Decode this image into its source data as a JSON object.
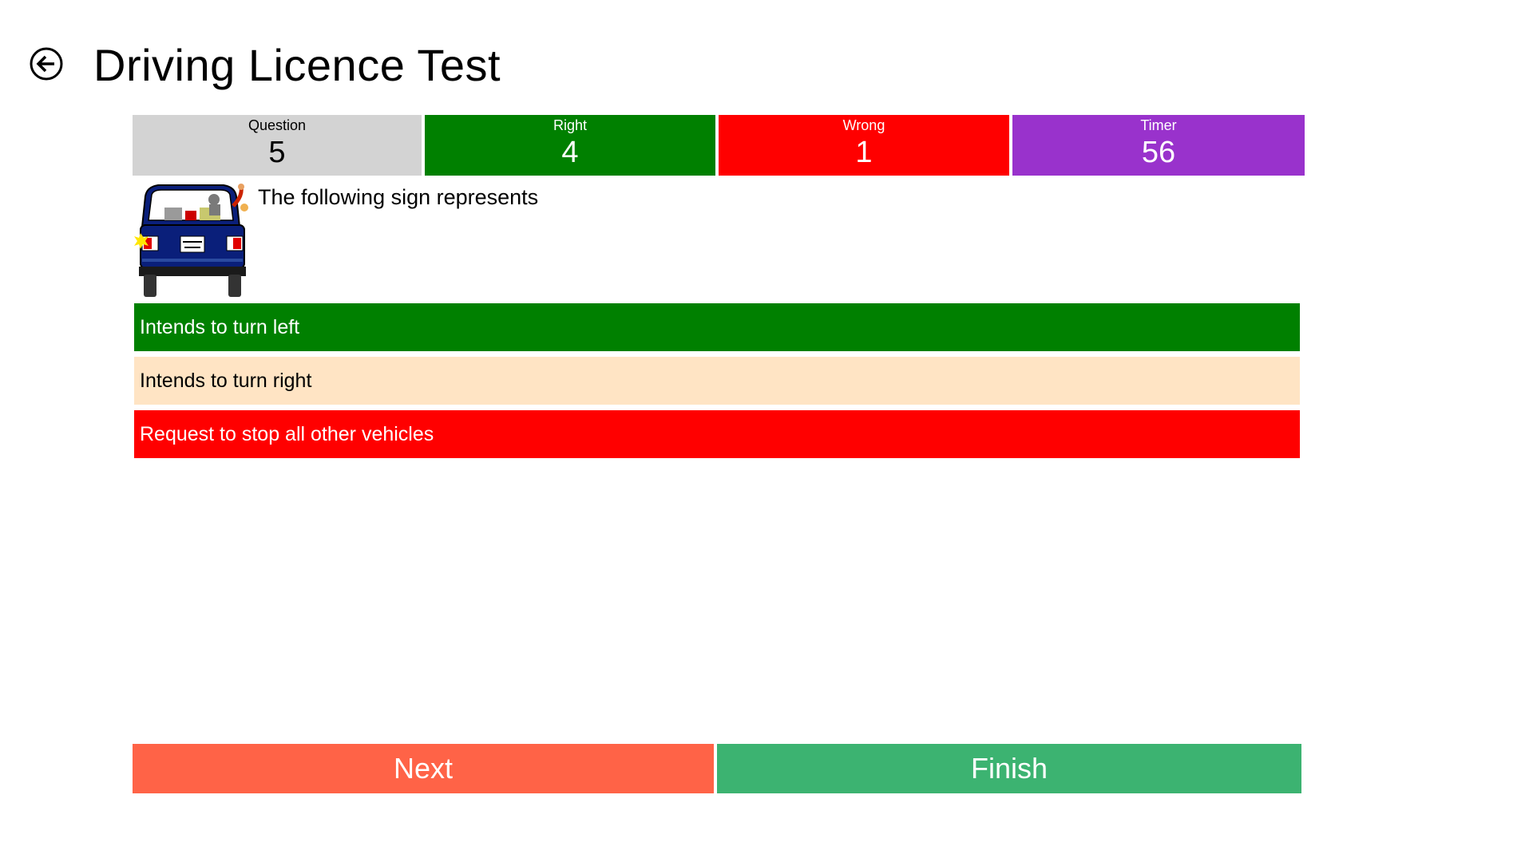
{
  "header": {
    "title": "Driving Licence Test",
    "back_icon": "back-arrow-circle-icon"
  },
  "stats": {
    "question": {
      "label": "Question",
      "value": "5",
      "color": "#d3d3d3"
    },
    "right": {
      "label": "Right",
      "value": "4",
      "color": "#008000"
    },
    "wrong": {
      "label": "Wrong",
      "value": "1",
      "color": "#ff0000"
    },
    "timer": {
      "label": "Timer",
      "value": "56",
      "color": "#9932cc"
    }
  },
  "question": {
    "text": "The following sign represents",
    "image": "driver-hand-signal-car-illustration"
  },
  "options": [
    {
      "label": "Intends to turn left",
      "state": "correct",
      "color": "#008000"
    },
    {
      "label": "Intends to turn right",
      "state": "neutral",
      "color": "#ffe4c4"
    },
    {
      "label": "Request to stop all other vehicles",
      "state": "wrong",
      "color": "#ff0000"
    }
  ],
  "buttons": {
    "next_label": "Next",
    "next_color": "#ff6347",
    "finish_label": "Finish",
    "finish_color": "#3cb371"
  }
}
